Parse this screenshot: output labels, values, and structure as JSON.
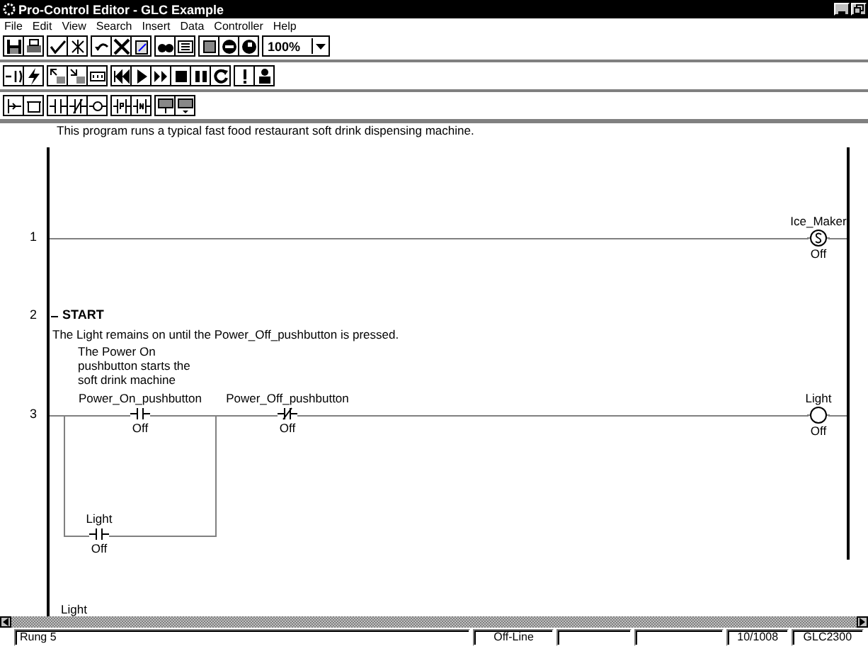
{
  "window": {
    "title": "Pro-Control Editor - GLC Example"
  },
  "menu": [
    "File",
    "Edit",
    "View",
    "Search",
    "Insert",
    "Data",
    "Controller",
    "Help"
  ],
  "zoom": {
    "value": "100%"
  },
  "description": "This program runs a typical fast food restaurant soft drink dispensing machine.",
  "rungs": [
    {
      "kind": "logic",
      "number": "1",
      "elements": [
        {
          "kind": "set_coil",
          "tag": "Ice_Maker",
          "status": "Off"
        }
      ]
    },
    {
      "kind": "header",
      "number": "2",
      "title": "START",
      "comment": "The Light remains on until the Power_Off_pushbutton is pressed.",
      "note": [
        "The Power On",
        "pushbutton starts the",
        "soft drink machine"
      ]
    },
    {
      "kind": "logic",
      "number": "3",
      "elements": [
        {
          "kind": "no_contact",
          "tag": "Power_On_pushbutton",
          "status": "Off"
        },
        {
          "kind": "nc_contact",
          "tag": "Power_Off_pushbutton",
          "status": "Off"
        },
        {
          "kind": "coil",
          "tag": "Light",
          "status": "Off"
        }
      ],
      "branch": [
        {
          "kind": "no_contact",
          "tag": "Light",
          "status": "Off"
        }
      ]
    },
    {
      "kind": "partial",
      "tag": "Light"
    }
  ],
  "status_bar": {
    "rung": "Rung 5",
    "mode": "Off-Line",
    "position": "10/1008",
    "model": "GLC2300"
  }
}
